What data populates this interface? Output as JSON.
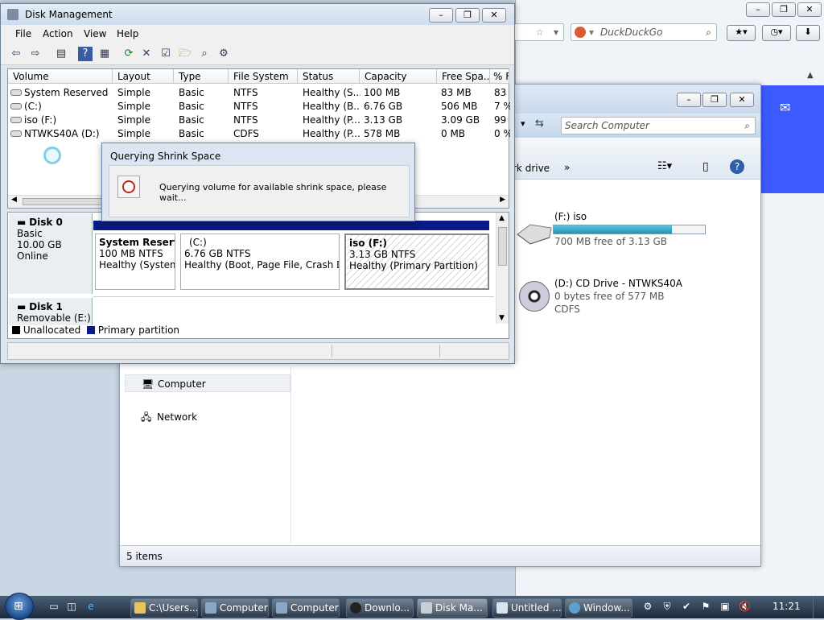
{
  "browser": {
    "search_engine": "DuckDuckGo",
    "accent": "#3d5afe"
  },
  "explorer": {
    "search_placeholder": "Search Computer",
    "cmd_partial": "rk drive",
    "cmd_more": "»",
    "nav": [
      {
        "label": "Computer"
      },
      {
        "label": "Network"
      }
    ],
    "drives": [
      {
        "name": "(F:) iso",
        "sub": "700 MB free of 3.13 GB",
        "used_fraction": 0.78
      },
      {
        "name": "(D:) CD Drive - NTWKS40A",
        "sub": "0 bytes free of 577 MB",
        "sub2": "CDFS"
      }
    ],
    "status": "5 items"
  },
  "dm": {
    "title": "Disk Management",
    "menu": [
      "File",
      "Action",
      "View",
      "Help"
    ],
    "columns": [
      "Volume",
      "Layout",
      "Type",
      "File System",
      "Status",
      "Capacity",
      "Free Spa...",
      "% F"
    ],
    "rows": [
      [
        "System Reserved",
        "Simple",
        "Basic",
        "NTFS",
        "Healthy (S...",
        "100 MB",
        "83 MB",
        "83"
      ],
      [
        "(C:)",
        "Simple",
        "Basic",
        "NTFS",
        "Healthy (B...",
        "6.76 GB",
        "506 MB",
        "7 %"
      ],
      [
        "iso (F:)",
        "Simple",
        "Basic",
        "NTFS",
        "Healthy (P...",
        "3.13 GB",
        "3.09 GB",
        "99"
      ],
      [
        "NTWKS40A (D:)",
        "Simple",
        "Basic",
        "CDFS",
        "Healthy (P...",
        "578 MB",
        "0 MB",
        "0 %"
      ]
    ],
    "disk0": {
      "name": "Disk 0",
      "type": "Basic",
      "size": "10.00 GB",
      "state": "Online"
    },
    "disk1": {
      "name": "Disk 1",
      "type": "Removable (E:)"
    },
    "partitions": [
      {
        "name": "System Reserve",
        "size": "100 MB NTFS",
        "status": "Healthy (System,"
      },
      {
        "name": "(C:)",
        "size": "6.76 GB NTFS",
        "status": "Healthy (Boot, Page File, Crash Dum"
      },
      {
        "name": "iso  (F:)",
        "size": "3.13 GB NTFS",
        "status": "Healthy (Primary Partition)"
      }
    ],
    "legend": {
      "unallocated": "Unallocated",
      "primary": "Primary partition"
    }
  },
  "dialog": {
    "title": "Querying Shrink Space",
    "message": "Querying volume for available shrink space, please wait..."
  },
  "taskbar": {
    "tasks": [
      "C:\\Users...",
      "Computer",
      "Computer",
      "Downlo...",
      "Disk Ma...",
      "Untitled ...",
      "Window..."
    ],
    "clock": "11:21"
  }
}
